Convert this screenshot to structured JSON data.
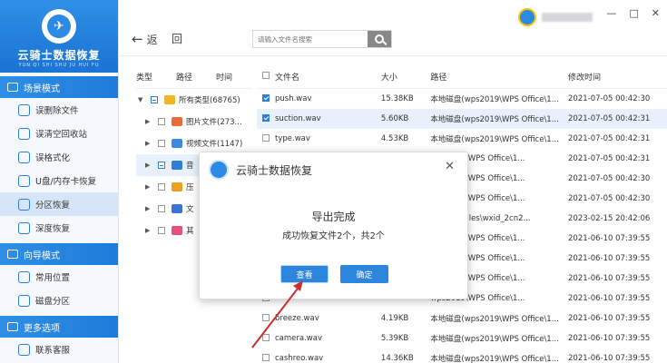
{
  "brand": {
    "name": "云骑士数据恢复",
    "subtitle": "YUN QI SHI SHU JU HUI FU"
  },
  "sidebar": {
    "sections": [
      {
        "title": "场景模式",
        "items": [
          "误删除文件",
          "误清空回收站",
          "误格式化",
          "U盘/内存卡恢复",
          "分区恢复",
          "深度恢复"
        ]
      },
      {
        "title": "向导模式",
        "items": [
          "常用位置",
          "磁盘分区"
        ]
      },
      {
        "title": "更多选项",
        "items": [
          "联系客服"
        ]
      }
    ],
    "active_item": "分区恢复"
  },
  "toolbar": {
    "back_label": "返",
    "home_label": "回",
    "search_placeholder": "请输入文件名搜索"
  },
  "window_controls": [
    "—",
    "□",
    "✕"
  ],
  "tree": {
    "headers": [
      "类型",
      "路径",
      "时间"
    ],
    "rows": [
      {
        "label": "所有类型(68765)",
        "caret": "▼",
        "check": "partial"
      },
      {
        "label": "图片文件(273...",
        "caret": "▶",
        "check": "none"
      },
      {
        "label": "视频文件(1147)",
        "caret": "▶",
        "check": "none"
      },
      {
        "label": "音",
        "caret": "▶",
        "check": "partial"
      },
      {
        "label": "压",
        "caret": "▶",
        "check": "none"
      },
      {
        "label": "文",
        "caret": "▶",
        "check": "none"
      },
      {
        "label": "其",
        "caret": "▶",
        "check": "none"
      }
    ],
    "icon_colors": [
      "#f5b521",
      "#e86b3a",
      "#3b8be0",
      "#2d7fd6",
      "#f0a020",
      "#3c73d8",
      "#e84f7a"
    ]
  },
  "table": {
    "headers": [
      "文件名",
      "大小",
      "路径",
      "修改时间"
    ],
    "rows": [
      {
        "checked": true,
        "name": "push.wav",
        "size": "15.38KB",
        "path": "本地磁盘(wps2019\\WPS Office\\1...",
        "date": "2021-07-05 00:42:30"
      },
      {
        "checked": true,
        "name": "suction.wav",
        "size": "5.60KB",
        "path": "本地磁盘(wps2019\\WPS Office\\1...",
        "date": "2021-07-05 00:42:31"
      },
      {
        "checked": false,
        "name": "type.wav",
        "size": "4.53KB",
        "path": "本地磁盘(wps2019\\WPS Office\\1...",
        "date": "2021-07-05 00:42:31"
      },
      {
        "checked": false,
        "name": "",
        "size": "",
        "path": "wps2019\\WPS Office\\1...",
        "date": "2021-07-05 00:42:31"
      },
      {
        "checked": false,
        "name": "",
        "size": "",
        "path": "wps2019\\WPS Office\\1...",
        "date": "2021-07-05 00:42:30"
      },
      {
        "checked": false,
        "name": "",
        "size": "",
        "path": "wps2019\\WPS Office\\1...",
        "date": "2021-07-05 00:42:30"
      },
      {
        "checked": false,
        "name": "",
        "size": "",
        "path": "WeChat Files\\wxid_2cn2...",
        "date": "2023-02-15 20:42:06"
      },
      {
        "checked": false,
        "name": "",
        "size": "",
        "path": "wps2019\\WPS Office\\1...",
        "date": "2021-06-10 07:39:55"
      },
      {
        "checked": false,
        "name": "",
        "size": "",
        "path": "wps2019\\WPS Office\\1...",
        "date": "2021-06-10 07:39:55"
      },
      {
        "checked": false,
        "name": "",
        "size": "",
        "path": "wps2019\\WPS Office\\1...",
        "date": "2021-06-10 07:39:55"
      },
      {
        "checked": false,
        "name": "",
        "size": "",
        "path": "wps2019\\WPS Office\\1...",
        "date": "2021-06-10 07:39:55"
      },
      {
        "checked": false,
        "name": "breeze.wav",
        "size": "4.19KB",
        "path": "本地磁盘(wps2019\\WPS Office\\1...",
        "date": "2021-06-10 07:39:55"
      },
      {
        "checked": false,
        "name": "camera.wav",
        "size": "5.39KB",
        "path": "本地磁盘(wps2019\\WPS Office\\1...",
        "date": "2021-06-10 07:39:55"
      },
      {
        "checked": false,
        "name": "cashreo.wav",
        "size": "14.36KB",
        "path": "本地磁盘(wps2019\\WPS Office\\1...",
        "date": "2021-06-10 07:39:55"
      }
    ]
  },
  "dialog": {
    "title": "云骑士数据恢复",
    "close": "✕",
    "heading": "导出完成",
    "message": "成功恢复文件2个，共2个",
    "view_label": "查看",
    "ok_label": "确定"
  },
  "colors": {
    "accent": "#2d86de",
    "annotation": "#c9302c"
  }
}
